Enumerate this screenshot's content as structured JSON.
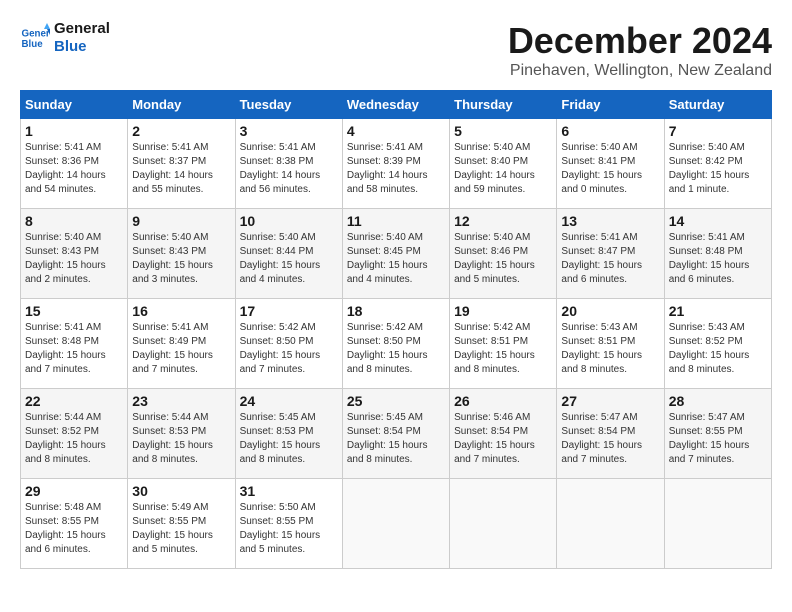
{
  "logo": {
    "line1": "General",
    "line2": "Blue"
  },
  "title": "December 2024",
  "location": "Pinehaven, Wellington, New Zealand",
  "weekdays": [
    "Sunday",
    "Monday",
    "Tuesday",
    "Wednesday",
    "Thursday",
    "Friday",
    "Saturday"
  ],
  "weeks": [
    [
      {
        "day": "1",
        "info": "Sunrise: 5:41 AM\nSunset: 8:36 PM\nDaylight: 14 hours\nand 54 minutes."
      },
      {
        "day": "2",
        "info": "Sunrise: 5:41 AM\nSunset: 8:37 PM\nDaylight: 14 hours\nand 55 minutes."
      },
      {
        "day": "3",
        "info": "Sunrise: 5:41 AM\nSunset: 8:38 PM\nDaylight: 14 hours\nand 56 minutes."
      },
      {
        "day": "4",
        "info": "Sunrise: 5:41 AM\nSunset: 8:39 PM\nDaylight: 14 hours\nand 58 minutes."
      },
      {
        "day": "5",
        "info": "Sunrise: 5:40 AM\nSunset: 8:40 PM\nDaylight: 14 hours\nand 59 minutes."
      },
      {
        "day": "6",
        "info": "Sunrise: 5:40 AM\nSunset: 8:41 PM\nDaylight: 15 hours\nand 0 minutes."
      },
      {
        "day": "7",
        "info": "Sunrise: 5:40 AM\nSunset: 8:42 PM\nDaylight: 15 hours\nand 1 minute."
      }
    ],
    [
      {
        "day": "8",
        "info": "Sunrise: 5:40 AM\nSunset: 8:43 PM\nDaylight: 15 hours\nand 2 minutes."
      },
      {
        "day": "9",
        "info": "Sunrise: 5:40 AM\nSunset: 8:43 PM\nDaylight: 15 hours\nand 3 minutes."
      },
      {
        "day": "10",
        "info": "Sunrise: 5:40 AM\nSunset: 8:44 PM\nDaylight: 15 hours\nand 4 minutes."
      },
      {
        "day": "11",
        "info": "Sunrise: 5:40 AM\nSunset: 8:45 PM\nDaylight: 15 hours\nand 4 minutes."
      },
      {
        "day": "12",
        "info": "Sunrise: 5:40 AM\nSunset: 8:46 PM\nDaylight: 15 hours\nand 5 minutes."
      },
      {
        "day": "13",
        "info": "Sunrise: 5:41 AM\nSunset: 8:47 PM\nDaylight: 15 hours\nand 6 minutes."
      },
      {
        "day": "14",
        "info": "Sunrise: 5:41 AM\nSunset: 8:48 PM\nDaylight: 15 hours\nand 6 minutes."
      }
    ],
    [
      {
        "day": "15",
        "info": "Sunrise: 5:41 AM\nSunset: 8:48 PM\nDaylight: 15 hours\nand 7 minutes."
      },
      {
        "day": "16",
        "info": "Sunrise: 5:41 AM\nSunset: 8:49 PM\nDaylight: 15 hours\nand 7 minutes."
      },
      {
        "day": "17",
        "info": "Sunrise: 5:42 AM\nSunset: 8:50 PM\nDaylight: 15 hours\nand 7 minutes."
      },
      {
        "day": "18",
        "info": "Sunrise: 5:42 AM\nSunset: 8:50 PM\nDaylight: 15 hours\nand 8 minutes."
      },
      {
        "day": "19",
        "info": "Sunrise: 5:42 AM\nSunset: 8:51 PM\nDaylight: 15 hours\nand 8 minutes."
      },
      {
        "day": "20",
        "info": "Sunrise: 5:43 AM\nSunset: 8:51 PM\nDaylight: 15 hours\nand 8 minutes."
      },
      {
        "day": "21",
        "info": "Sunrise: 5:43 AM\nSunset: 8:52 PM\nDaylight: 15 hours\nand 8 minutes."
      }
    ],
    [
      {
        "day": "22",
        "info": "Sunrise: 5:44 AM\nSunset: 8:52 PM\nDaylight: 15 hours\nand 8 minutes."
      },
      {
        "day": "23",
        "info": "Sunrise: 5:44 AM\nSunset: 8:53 PM\nDaylight: 15 hours\nand 8 minutes."
      },
      {
        "day": "24",
        "info": "Sunrise: 5:45 AM\nSunset: 8:53 PM\nDaylight: 15 hours\nand 8 minutes."
      },
      {
        "day": "25",
        "info": "Sunrise: 5:45 AM\nSunset: 8:54 PM\nDaylight: 15 hours\nand 8 minutes."
      },
      {
        "day": "26",
        "info": "Sunrise: 5:46 AM\nSunset: 8:54 PM\nDaylight: 15 hours\nand 7 minutes."
      },
      {
        "day": "27",
        "info": "Sunrise: 5:47 AM\nSunset: 8:54 PM\nDaylight: 15 hours\nand 7 minutes."
      },
      {
        "day": "28",
        "info": "Sunrise: 5:47 AM\nSunset: 8:55 PM\nDaylight: 15 hours\nand 7 minutes."
      }
    ],
    [
      {
        "day": "29",
        "info": "Sunrise: 5:48 AM\nSunset: 8:55 PM\nDaylight: 15 hours\nand 6 minutes."
      },
      {
        "day": "30",
        "info": "Sunrise: 5:49 AM\nSunset: 8:55 PM\nDaylight: 15 hours\nand 5 minutes."
      },
      {
        "day": "31",
        "info": "Sunrise: 5:50 AM\nSunset: 8:55 PM\nDaylight: 15 hours\nand 5 minutes."
      },
      {
        "day": "",
        "info": ""
      },
      {
        "day": "",
        "info": ""
      },
      {
        "day": "",
        "info": ""
      },
      {
        "day": "",
        "info": ""
      }
    ]
  ]
}
